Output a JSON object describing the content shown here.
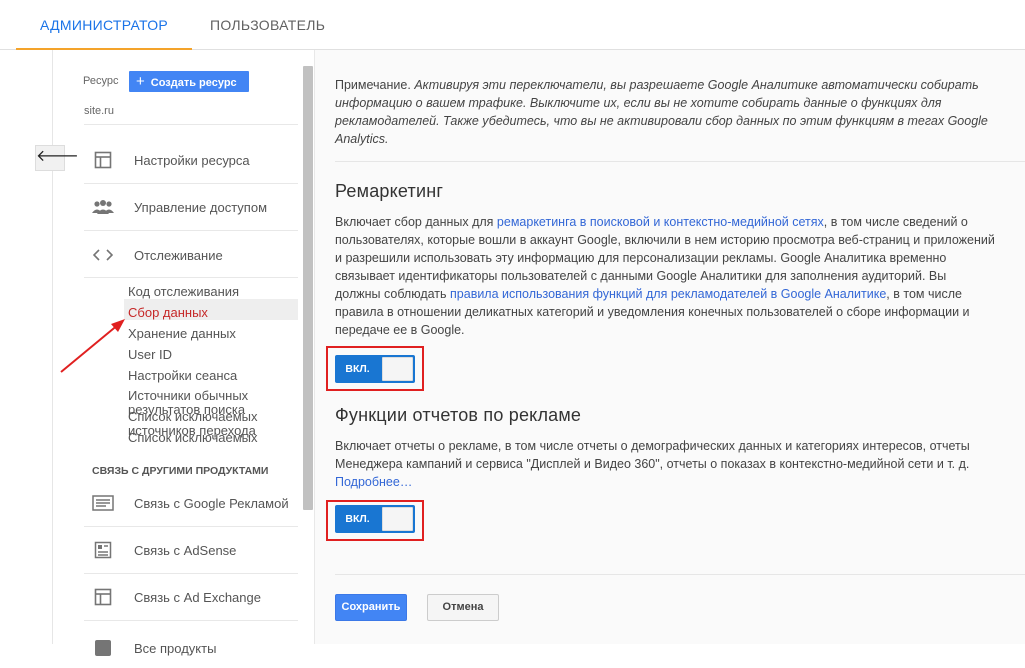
{
  "tabs": [
    {
      "label": "АДМИНИСТРАТОР",
      "active": true
    },
    {
      "label": "ПОЛЬЗОВАТЕЛЬ",
      "active": false
    }
  ],
  "sidebar": {
    "resource_label": "Ресурс",
    "create_button": "Создать ресурс",
    "site": "site.ru",
    "back_glyph": "🡐",
    "items": [
      {
        "label": "Настройки ресурса",
        "icon": "layout-icon"
      },
      {
        "label": "Управление доступом",
        "icon": "people-icon"
      },
      {
        "label": "Отслеживание",
        "icon": "code-icon"
      }
    ],
    "tracking_sub": [
      {
        "label": "Код отслеживания"
      },
      {
        "label": "Сбор данных",
        "active": true
      },
      {
        "label": "Хранение данных"
      },
      {
        "label": "User ID"
      },
      {
        "label": "Настройки сеанса"
      },
      {
        "label": "Источники обычных результатов поиска"
      },
      {
        "label": "Список исключаемых источников перехода"
      },
      {
        "label": "Список исключаемых поисковых запросов"
      }
    ],
    "group_header": "СВЯЗЬ С ДРУГИМИ ПРОДУКТАМИ",
    "product_links": [
      {
        "label": "Связь с Google Рекламой",
        "icon": "ads-icon"
      },
      {
        "label": "Связь с AdSense",
        "icon": "adsense-icon"
      },
      {
        "label": "Связь с Ad Exchange",
        "icon": "adexchange-icon"
      },
      {
        "label": "Все продукты",
        "icon": "products-icon"
      }
    ]
  },
  "main": {
    "note_prefix": "Примечание.",
    "note_text": "Активируя эти переключатели, вы разрешаете Google Аналитике автоматически собирать информацию о вашем трафике. Выключите их, если вы не хотите собирать данные о функциях для рекламодателей. Также убедитесь, что вы не активировали сбор данных по этим функциям в тегах Google Analytics.",
    "remarketing": {
      "title": "Ремаркетинг",
      "text_1": "Включает сбор данных для ",
      "link_1": "ремаркетинга в поисковой и контекстно-медийной сетях",
      "text_2": ", в том числе сведений о пользователях, которые вошли в аккаунт Google, включили в нем историю просмотра веб-страниц и приложений и разрешили использовать эту информацию для персонализации рекламы. Google Аналитика временно связывает идентификаторы пользователей с данными Google Аналитики для заполнения аудиторий. Вы должны соблюдать ",
      "link_2": "правила использования функций для рекламодателей в Google Аналитике",
      "text_3": ", в том числе правила в отношении деликатных категорий и уведомления конечных пользователей о сборе информации и передаче ее в Google.",
      "toggle_label": "ВКЛ."
    },
    "ad_reports": {
      "title": "Функции отчетов по рекламе",
      "text": "Включает отчеты о рекламе, в том числе отчеты о демографических данных и категориях интересов, отчеты Менеджера кампаний и сервиса \"Дисплей и Видео 360\", отчеты о показах в контекстно-медийной сети и т. д. ",
      "link": "Подробнее…",
      "toggle_label": "ВКЛ."
    },
    "save_button": "Сохранить",
    "cancel_button": "Отмена"
  },
  "colors": {
    "accent": "#4285f4",
    "tab_underline": "#f4a32a",
    "highlight": "#e02020",
    "active_sub": "#c62828"
  }
}
